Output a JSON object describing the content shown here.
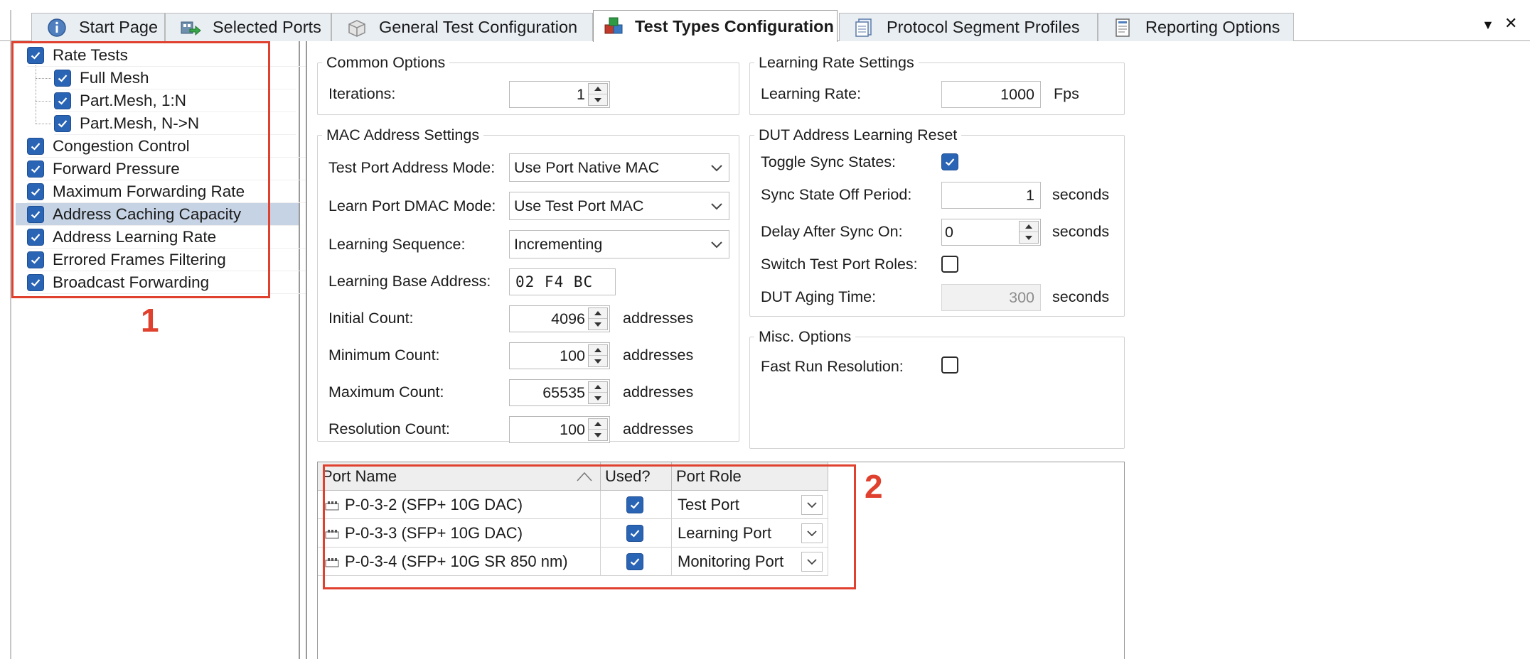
{
  "tabs": [
    {
      "label": "Start Page",
      "icon": "info-icon"
    },
    {
      "label": "Selected Ports",
      "icon": "ports-arrow-icon"
    },
    {
      "label": "General Test Configuration",
      "icon": "box-icon"
    },
    {
      "label": "Test Types Configuration",
      "icon": "cubes-icon",
      "active": true
    },
    {
      "label": "Protocol Segment Profiles",
      "icon": "document-icon"
    },
    {
      "label": "Reporting Options",
      "icon": "report-icon"
    }
  ],
  "tab_controls": {
    "dropdown": "▼",
    "close": "✕"
  },
  "tree": [
    {
      "label": "Rate Tests",
      "checked": true,
      "level": 0
    },
    {
      "label": "Full Mesh",
      "checked": true,
      "level": 1
    },
    {
      "label": "Part.Mesh, 1:N",
      "checked": true,
      "level": 1
    },
    {
      "label": "Part.Mesh, N->N",
      "checked": true,
      "level": 1
    },
    {
      "label": "Congestion Control",
      "checked": true,
      "level": 0
    },
    {
      "label": "Forward Pressure",
      "checked": true,
      "level": 0
    },
    {
      "label": "Maximum Forwarding Rate",
      "checked": true,
      "level": 0
    },
    {
      "label": "Address Caching Capacity",
      "checked": true,
      "level": 0,
      "selected": true
    },
    {
      "label": "Address Learning Rate",
      "checked": true,
      "level": 0
    },
    {
      "label": "Errored Frames Filtering",
      "checked": true,
      "level": 0
    },
    {
      "label": "Broadcast Forwarding",
      "checked": true,
      "level": 0
    }
  ],
  "annotations": {
    "one": "1",
    "two": "2",
    "color": "#e0402e"
  },
  "common_options": {
    "title": "Common Options",
    "iterations_label": "Iterations:",
    "iterations_value": "1"
  },
  "learning_rate_settings": {
    "title": "Learning Rate Settings",
    "rate_label": "Learning Rate:",
    "rate_value": "1000",
    "rate_unit": "Fps"
  },
  "mac_settings": {
    "title": "MAC Address Settings",
    "test_port_mode_label": "Test Port Address Mode:",
    "test_port_mode_value": "Use Port Native MAC",
    "learn_port_dmac_label": "Learn Port DMAC Mode:",
    "learn_port_dmac_value": "Use Test Port MAC",
    "learning_sequence_label": "Learning Sequence:",
    "learning_sequence_value": "Incrementing",
    "base_address_label": "Learning Base Address:",
    "base_address_value": "02 F4 BC",
    "initial_count_label": "Initial Count:",
    "initial_count_value": "4096",
    "minimum_count_label": "Minimum Count:",
    "minimum_count_value": "100",
    "maximum_count_label": "Maximum Count:",
    "maximum_count_value": "65535",
    "resolution_count_label": "Resolution Count:",
    "resolution_count_value": "100",
    "unit": "addresses"
  },
  "dut_reset": {
    "title": "DUT Address Learning Reset",
    "toggle_sync_label": "Toggle Sync States:",
    "toggle_sync_checked": true,
    "sync_off_label": "Sync State Off Period:",
    "sync_off_value": "1",
    "delay_after_label": "Delay After Sync On:",
    "delay_after_value": "0",
    "switch_roles_label": "Switch Test Port Roles:",
    "switch_roles_checked": false,
    "aging_label": "DUT Aging Time:",
    "aging_value": "300",
    "unit": "seconds"
  },
  "misc_options": {
    "title": "Misc. Options",
    "fast_run_label": "Fast Run Resolution:",
    "fast_run_checked": false
  },
  "grid": {
    "columns": [
      "Port Name",
      "Used?",
      "Port Role"
    ],
    "rows": [
      {
        "port": "P-0-3-2 (SFP+ 10G DAC)",
        "used": true,
        "role": "Test Port"
      },
      {
        "port": "P-0-3-3 (SFP+ 10G DAC)",
        "used": true,
        "role": "Learning Port"
      },
      {
        "port": "P-0-3-4 (SFP+ 10G SR 850 nm)",
        "used": true,
        "role": "Monitoring Port"
      }
    ]
  },
  "colors": {
    "accent": "#2a64b4",
    "selection": "#c5d3e4",
    "annotation": "#e0402e"
  }
}
